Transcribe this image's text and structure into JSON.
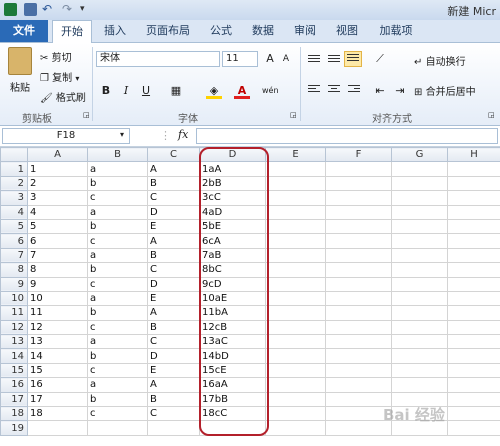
{
  "title_bar": {
    "title": "新建 Micr"
  },
  "tabs": [
    {
      "label": "文件",
      "kind": "file"
    },
    {
      "label": "开始",
      "kind": "active"
    },
    {
      "label": "插入"
    },
    {
      "label": "页面布局"
    },
    {
      "label": "公式"
    },
    {
      "label": "数据"
    },
    {
      "label": "审阅"
    },
    {
      "label": "视图"
    },
    {
      "label": "加载项"
    }
  ],
  "clipboard": {
    "paste": "粘贴",
    "cut": "剪切",
    "copy": "复制",
    "format_painter": "格式刷",
    "group": "剪贴板"
  },
  "font": {
    "name": "宋体",
    "size": "11",
    "grow": "A",
    "shrink": "A",
    "bold": "B",
    "italic": "I",
    "underline": "U",
    "font_color": "A",
    "phonetic": "wén",
    "group": "字体"
  },
  "alignment": {
    "wrap_text": "自动换行",
    "merge_center": "合并后居中",
    "group": "对齐方式"
  },
  "formula_bar": {
    "name_box": "F18",
    "fx": "fx",
    "value": ""
  },
  "columns": [
    "A",
    "B",
    "C",
    "D",
    "E",
    "F",
    "G",
    "H"
  ],
  "rows": [
    {
      "num": "1",
      "cells": [
        "1",
        "a",
        "A",
        "1aA",
        "",
        "",
        "",
        ""
      ]
    },
    {
      "num": "2",
      "cells": [
        "2",
        "b",
        "B",
        "2bB",
        "",
        "",
        "",
        ""
      ]
    },
    {
      "num": "3",
      "cells": [
        "3",
        "c",
        "C",
        "3cC",
        "",
        "",
        "",
        ""
      ]
    },
    {
      "num": "4",
      "cells": [
        "4",
        "a",
        "D",
        "4aD",
        "",
        "",
        "",
        ""
      ]
    },
    {
      "num": "5",
      "cells": [
        "5",
        "b",
        "E",
        "5bE",
        "",
        "",
        "",
        ""
      ]
    },
    {
      "num": "6",
      "cells": [
        "6",
        "c",
        "A",
        "6cA",
        "",
        "",
        "",
        ""
      ]
    },
    {
      "num": "7",
      "cells": [
        "7",
        "a",
        "B",
        "7aB",
        "",
        "",
        "",
        ""
      ]
    },
    {
      "num": "8",
      "cells": [
        "8",
        "b",
        "C",
        "8bC",
        "",
        "",
        "",
        ""
      ]
    },
    {
      "num": "9",
      "cells": [
        "9",
        "c",
        "D",
        "9cD",
        "",
        "",
        "",
        ""
      ]
    },
    {
      "num": "10",
      "cells": [
        "10",
        "a",
        "E",
        "10aE",
        "",
        "",
        "",
        ""
      ]
    },
    {
      "num": "11",
      "cells": [
        "11",
        "b",
        "A",
        "11bA",
        "",
        "",
        "",
        ""
      ]
    },
    {
      "num": "12",
      "cells": [
        "12",
        "c",
        "B",
        "12cB",
        "",
        "",
        "",
        ""
      ]
    },
    {
      "num": "13",
      "cells": [
        "13",
        "a",
        "C",
        "13aC",
        "",
        "",
        "",
        ""
      ]
    },
    {
      "num": "14",
      "cells": [
        "14",
        "b",
        "D",
        "14bD",
        "",
        "",
        "",
        ""
      ]
    },
    {
      "num": "15",
      "cells": [
        "15",
        "c",
        "E",
        "15cE",
        "",
        "",
        "",
        ""
      ]
    },
    {
      "num": "16",
      "cells": [
        "16",
        "a",
        "A",
        "16aA",
        "",
        "",
        "",
        ""
      ]
    },
    {
      "num": "17",
      "cells": [
        "17",
        "b",
        "B",
        "17bB",
        "",
        "",
        "",
        ""
      ]
    },
    {
      "num": "18",
      "cells": [
        "18",
        "c",
        "C",
        "18cC",
        "",
        "",
        "",
        ""
      ]
    },
    {
      "num": "19",
      "cells": [
        "",
        "",
        "",
        "",
        "",
        "",
        "",
        ""
      ]
    }
  ],
  "watermark": "Bai 经验",
  "colors": {
    "file_tab": "#2a6ab7",
    "highlight_border": "#b3202b",
    "ribbon_border": "#a9bfd6"
  }
}
